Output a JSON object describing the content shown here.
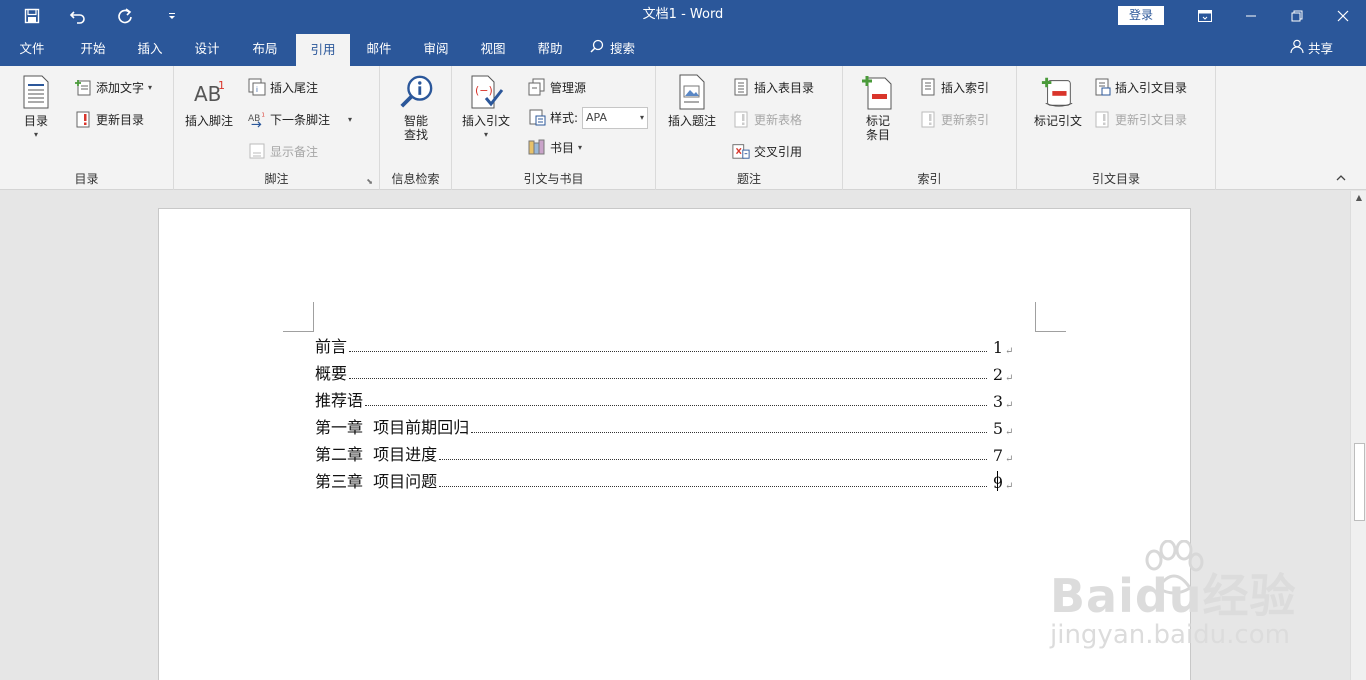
{
  "window": {
    "title": "文档1  -  Word",
    "login_label": "登录"
  },
  "tabs": [
    {
      "label": "文件"
    },
    {
      "label": "开始"
    },
    {
      "label": "插入"
    },
    {
      "label": "设计"
    },
    {
      "label": "布局"
    },
    {
      "label": "引用"
    },
    {
      "label": "邮件"
    },
    {
      "label": "审阅"
    },
    {
      "label": "视图"
    },
    {
      "label": "帮助"
    }
  ],
  "active_tab": "引用",
  "search_label": "搜索",
  "share_label": "共享",
  "ribbon": {
    "toc": {
      "group_label": "目录",
      "toc_button": "目录",
      "add_text": "添加文字",
      "update_toc": "更新目录"
    },
    "footnotes": {
      "group_label": "脚注",
      "insert_footnote": "插入脚注",
      "insert_endnote": "插入尾注",
      "next_footnote": "下一条脚注",
      "show_notes": "显示备注"
    },
    "research": {
      "group_label": "信息检索",
      "smart_lookup_line1": "智能",
      "smart_lookup_line2": "查找"
    },
    "citations": {
      "group_label": "引文与书目",
      "insert_citation": "插入引文",
      "manage_sources": "管理源",
      "style_label": "样式:",
      "style_value": "APA",
      "bibliography": "书目"
    },
    "captions": {
      "group_label": "题注",
      "insert_caption": "插入题注",
      "insert_table_of_figures": "插入表目录",
      "update_table": "更新表格",
      "cross_reference": "交叉引用"
    },
    "index": {
      "group_label": "索引",
      "mark_entry_line1": "标记",
      "mark_entry_line2": "条目",
      "insert_index": "插入索引",
      "update_index": "更新索引"
    },
    "authorities": {
      "group_label": "引文目录",
      "mark_citation": "标记引文",
      "insert_table_of_authorities": "插入引文目录",
      "update_table": "更新引文目录"
    }
  },
  "document": {
    "toc_entries": [
      {
        "text": "前言",
        "page": "1"
      },
      {
        "text": "概要",
        "page": "2"
      },
      {
        "text": "推荐语",
        "page": "3"
      },
      {
        "text": "第一章  项目前期回归",
        "page": "5"
      },
      {
        "text": "第二章  项目进度",
        "page": "7"
      },
      {
        "text": "第三章  项目问题",
        "page": "9"
      }
    ],
    "paragraph_mark": "↵"
  },
  "watermark": {
    "main": "Baidu经验",
    "sub": "jingyan.baidu.com"
  }
}
